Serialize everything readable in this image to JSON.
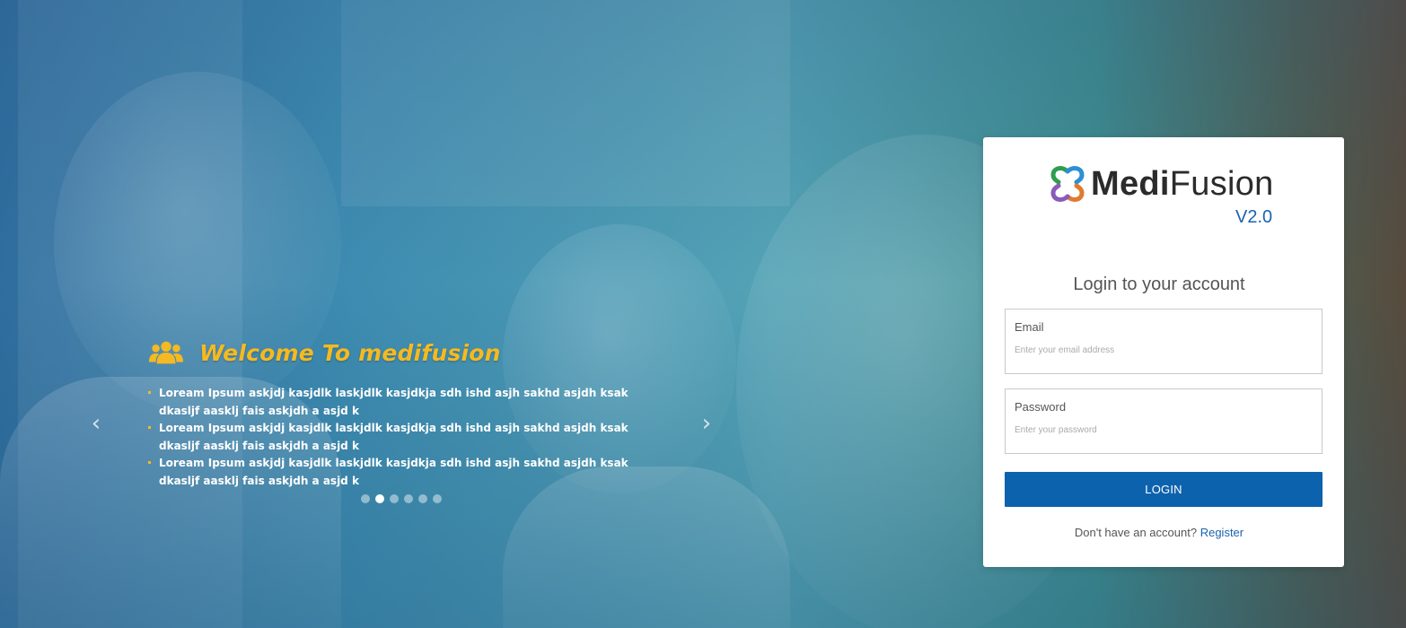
{
  "carousel": {
    "title": "Welcome To medifusion",
    "title_icon": "users-icon",
    "bullets": [
      "Loream Ipsum askjdj kasjdlk laskjdlk kasjdkja sdh ishd asjh sakhd asjdh ksak dkasljf aasklj fais askjdh a asjd k",
      "Loream Ipsum askjdj kasjdlk laskjdlk kasjdkja sdh ishd asjh sakhd asjdh ksak dkasljf aasklj fais askjdh a asjd k",
      "Loream Ipsum askjdj kasjdlk laskjdlk kasjdkja sdh ishd asjh sakhd asjdh ksak dkasljf aasklj fais askjdh a asjd k"
    ],
    "prev_arrow": "‹",
    "next_arrow": "›",
    "slide_count": 6,
    "active_slide": 2
  },
  "login": {
    "brand_bold": "Medi",
    "brand_light": "Fusion",
    "version": "V2.0",
    "title": "Login to your account",
    "email_label": "Email",
    "email_placeholder": "Enter your email address",
    "password_label": "Password",
    "password_placeholder": "Enter your password",
    "login_button": "LOGIN",
    "no_account_text": "Don't have an account?",
    "register_link": "Register"
  },
  "colors": {
    "accent_yellow": "#f5b921",
    "primary_blue": "#0d62ad",
    "link_blue": "#1a63ad"
  }
}
